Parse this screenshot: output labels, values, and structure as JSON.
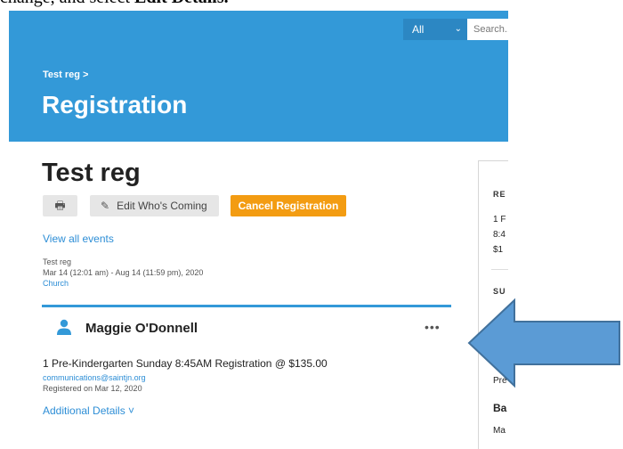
{
  "caption": {
    "before": "change, and select ",
    "bold": "Edit Details."
  },
  "header": {
    "scope_label": "All",
    "search_placeholder": "Search..",
    "breadcrumb": "Test reg >",
    "title": "Registration"
  },
  "event": {
    "title": "Test reg",
    "buttons": {
      "print_icon": "printer-icon",
      "edit_label": "Edit Who's Coming",
      "cancel_label": "Cancel Registration"
    },
    "view_all": "View all events",
    "name": "Test reg",
    "dates": "Mar 14 (12:01 am) - Aug 14 (11:59 pm), 2020",
    "location": "Church"
  },
  "registrant": {
    "icon": "person-icon",
    "name": "Maggie O'Donnell",
    "more": "•••",
    "line": "1 Pre-Kindergarten Sunday 8:45AM Registration @ $135.00",
    "email": "communications@saintjn.org",
    "registered": "Registered on Mar 12, 2020",
    "details_link": "Additional Details ˅"
  },
  "side_panel": {
    "heading1": "RE",
    "line1": "1 F",
    "line2": "8:4",
    "line3": "$1",
    "heading2": "SU",
    "link": "Pre",
    "label": "Ba",
    "link2": "Ma"
  },
  "annotation": {
    "arrow_color": "#5b9bd5",
    "arrow_direction": "left"
  }
}
